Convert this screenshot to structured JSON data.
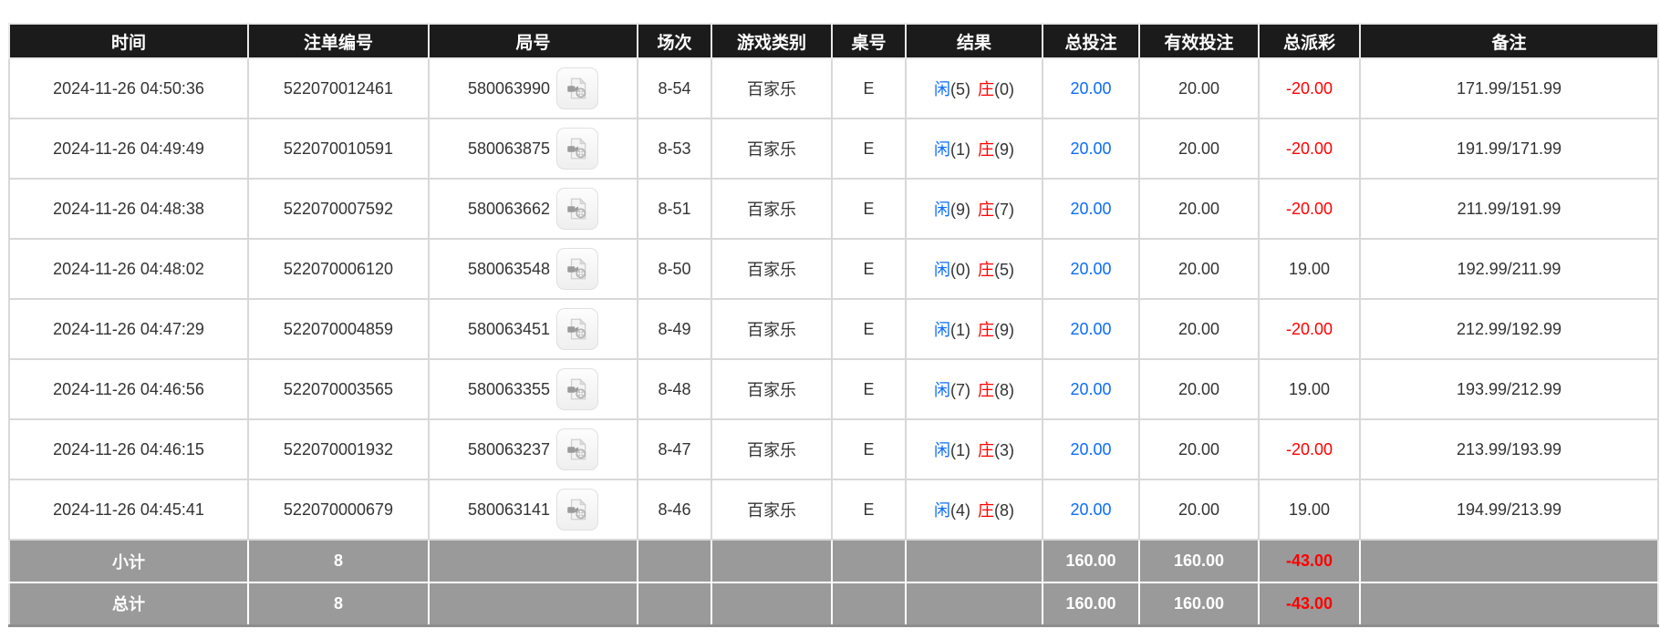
{
  "colors": {
    "header_bg": "#1b1b1b",
    "summary_bg": "#9a9a9a",
    "bet_blue": "#0b6cfb",
    "negative_red": "#ff0000"
  },
  "table": {
    "columns": [
      {
        "key": "time",
        "label": "时间"
      },
      {
        "key": "bet_id",
        "label": "注单编号"
      },
      {
        "key": "round_id",
        "label": "局号"
      },
      {
        "key": "session",
        "label": "场次"
      },
      {
        "key": "game_type",
        "label": "游戏类别"
      },
      {
        "key": "table_no",
        "label": "桌号"
      },
      {
        "key": "result",
        "label": "结果"
      },
      {
        "key": "total_bet",
        "label": "总投注"
      },
      {
        "key": "valid_bet",
        "label": "有效投注"
      },
      {
        "key": "total_payout",
        "label": "总派彩"
      },
      {
        "key": "remark",
        "label": "备注"
      }
    ],
    "result_labels": {
      "player": "闲",
      "banker": "庄"
    },
    "video_icon": "video-file-icon",
    "rows": [
      {
        "time": "2024-11-26 04:50:36",
        "bet_id": "522070012461",
        "round_id": "580063990",
        "session": "8-54",
        "game_type": "百家乐",
        "table_no": "E",
        "player_pts": "(5)",
        "banker_pts": "(0)",
        "total_bet": "20.00",
        "valid_bet": "20.00",
        "total_payout": "-20.00",
        "remark": "171.99/151.99"
      },
      {
        "time": "2024-11-26 04:49:49",
        "bet_id": "522070010591",
        "round_id": "580063875",
        "session": "8-53",
        "game_type": "百家乐",
        "table_no": "E",
        "player_pts": "(1)",
        "banker_pts": "(9)",
        "total_bet": "20.00",
        "valid_bet": "20.00",
        "total_payout": "-20.00",
        "remark": "191.99/171.99"
      },
      {
        "time": "2024-11-26 04:48:38",
        "bet_id": "522070007592",
        "round_id": "580063662",
        "session": "8-51",
        "game_type": "百家乐",
        "table_no": "E",
        "player_pts": "(9)",
        "banker_pts": "(7)",
        "total_bet": "20.00",
        "valid_bet": "20.00",
        "total_payout": "-20.00",
        "remark": "211.99/191.99"
      },
      {
        "time": "2024-11-26 04:48:02",
        "bet_id": "522070006120",
        "round_id": "580063548",
        "session": "8-50",
        "game_type": "百家乐",
        "table_no": "E",
        "player_pts": "(0)",
        "banker_pts": "(5)",
        "total_bet": "20.00",
        "valid_bet": "20.00",
        "total_payout": "19.00",
        "remark": "192.99/211.99"
      },
      {
        "time": "2024-11-26 04:47:29",
        "bet_id": "522070004859",
        "round_id": "580063451",
        "session": "8-49",
        "game_type": "百家乐",
        "table_no": "E",
        "player_pts": "(1)",
        "banker_pts": "(9)",
        "total_bet": "20.00",
        "valid_bet": "20.00",
        "total_payout": "-20.00",
        "remark": "212.99/192.99"
      },
      {
        "time": "2024-11-26 04:46:56",
        "bet_id": "522070003565",
        "round_id": "580063355",
        "session": "8-48",
        "game_type": "百家乐",
        "table_no": "E",
        "player_pts": "(7)",
        "banker_pts": "(8)",
        "total_bet": "20.00",
        "valid_bet": "20.00",
        "total_payout": "19.00",
        "remark": "193.99/212.99"
      },
      {
        "time": "2024-11-26 04:46:15",
        "bet_id": "522070001932",
        "round_id": "580063237",
        "session": "8-47",
        "game_type": "百家乐",
        "table_no": "E",
        "player_pts": "(1)",
        "banker_pts": "(3)",
        "total_bet": "20.00",
        "valid_bet": "20.00",
        "total_payout": "-20.00",
        "remark": "213.99/193.99"
      },
      {
        "time": "2024-11-26 04:45:41",
        "bet_id": "522070000679",
        "round_id": "580063141",
        "session": "8-46",
        "game_type": "百家乐",
        "table_no": "E",
        "player_pts": "(4)",
        "banker_pts": "(8)",
        "total_bet": "20.00",
        "valid_bet": "20.00",
        "total_payout": "19.00",
        "remark": "194.99/213.99"
      }
    ],
    "summary_rows": [
      {
        "label": "小计",
        "count": "8",
        "total_bet": "160.00",
        "valid_bet": "160.00",
        "total_payout": "-43.00"
      },
      {
        "label": "总计",
        "count": "8",
        "total_bet": "160.00",
        "valid_bet": "160.00",
        "total_payout": "-43.00"
      }
    ]
  }
}
